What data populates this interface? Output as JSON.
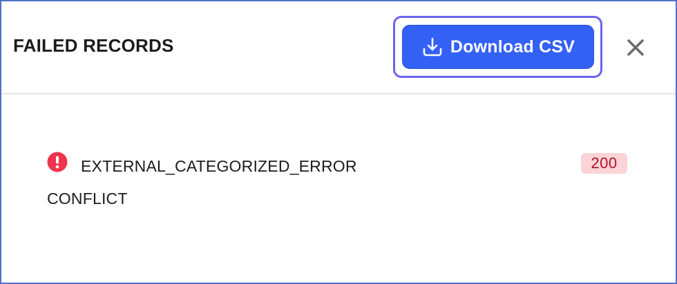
{
  "dialog": {
    "title": "FAILED RECORDS",
    "download_button_label": "Download CSV",
    "download_icon": "download-icon",
    "close_icon": "close-icon"
  },
  "records": [
    {
      "icon": "error-alert-icon",
      "error_code": "EXTERNAL_CATEGORIZED_ERROR",
      "status": "200",
      "message": "CONFLICT"
    }
  ],
  "colors": {
    "accent": "#3361f5",
    "focus_ring": "#6b63ee",
    "error": "#f0334f",
    "badge_bg": "#fcd3d6",
    "badge_text": "#b3122a"
  }
}
